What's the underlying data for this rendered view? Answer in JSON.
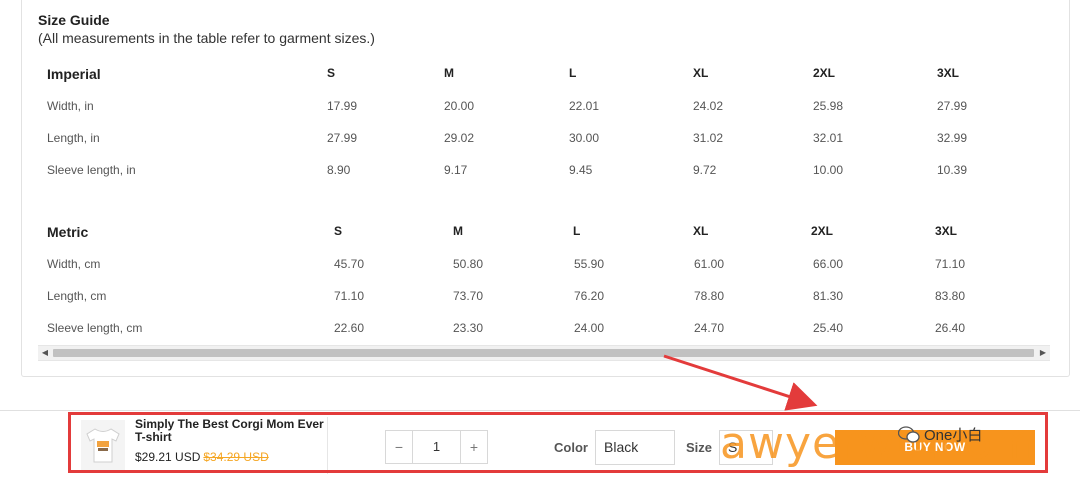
{
  "size_guide": {
    "title": "Size Guide",
    "subtitle": "(All measurements in the table refer to garment sizes.)",
    "imperial": {
      "header": [
        "Imperial",
        "S",
        "M",
        "L",
        "XL",
        "2XL",
        "3XL"
      ],
      "rows": [
        [
          "Width, in",
          "17.99",
          "20.00",
          "22.01",
          "24.02",
          "25.98",
          "27.99"
        ],
        [
          "Length, in",
          "27.99",
          "29.02",
          "30.00",
          "31.02",
          "32.01",
          "32.99"
        ],
        [
          "Sleeve length, in",
          "8.90",
          "9.17",
          "9.45",
          "9.72",
          "10.00",
          "10.39"
        ]
      ]
    },
    "metric": {
      "header": [
        "Metric",
        "S",
        "M",
        "L",
        "XL",
        "2XL",
        "3XL"
      ],
      "rows": [
        [
          "Width, cm",
          "45.70",
          "50.80",
          "55.90",
          "61.00",
          "66.00",
          "71.10"
        ],
        [
          "Length, cm",
          "71.10",
          "73.70",
          "76.20",
          "78.80",
          "81.30",
          "83.80"
        ],
        [
          "Sleeve length, cm",
          "22.60",
          "23.30",
          "24.00",
          "24.70",
          "25.40",
          "26.40"
        ]
      ]
    }
  },
  "sticky": {
    "product_name": "Simply The Best Corgi Mom Ever T-shirt",
    "price": "$29.21 USD",
    "old_price": "$34.29 USD",
    "quantity": "1",
    "minus": "−",
    "plus": "+",
    "color_label": "Color",
    "color_value": "Black",
    "size_label": "Size",
    "size_value": "S",
    "buy_label": "BUY NOW"
  },
  "overlay": {
    "watermark": "awyerwu.com",
    "wechat_name": "One小白"
  },
  "colors": {
    "accent": "#f7941d",
    "highlight": "#e33b3b",
    "old_price": "#f5a623"
  }
}
